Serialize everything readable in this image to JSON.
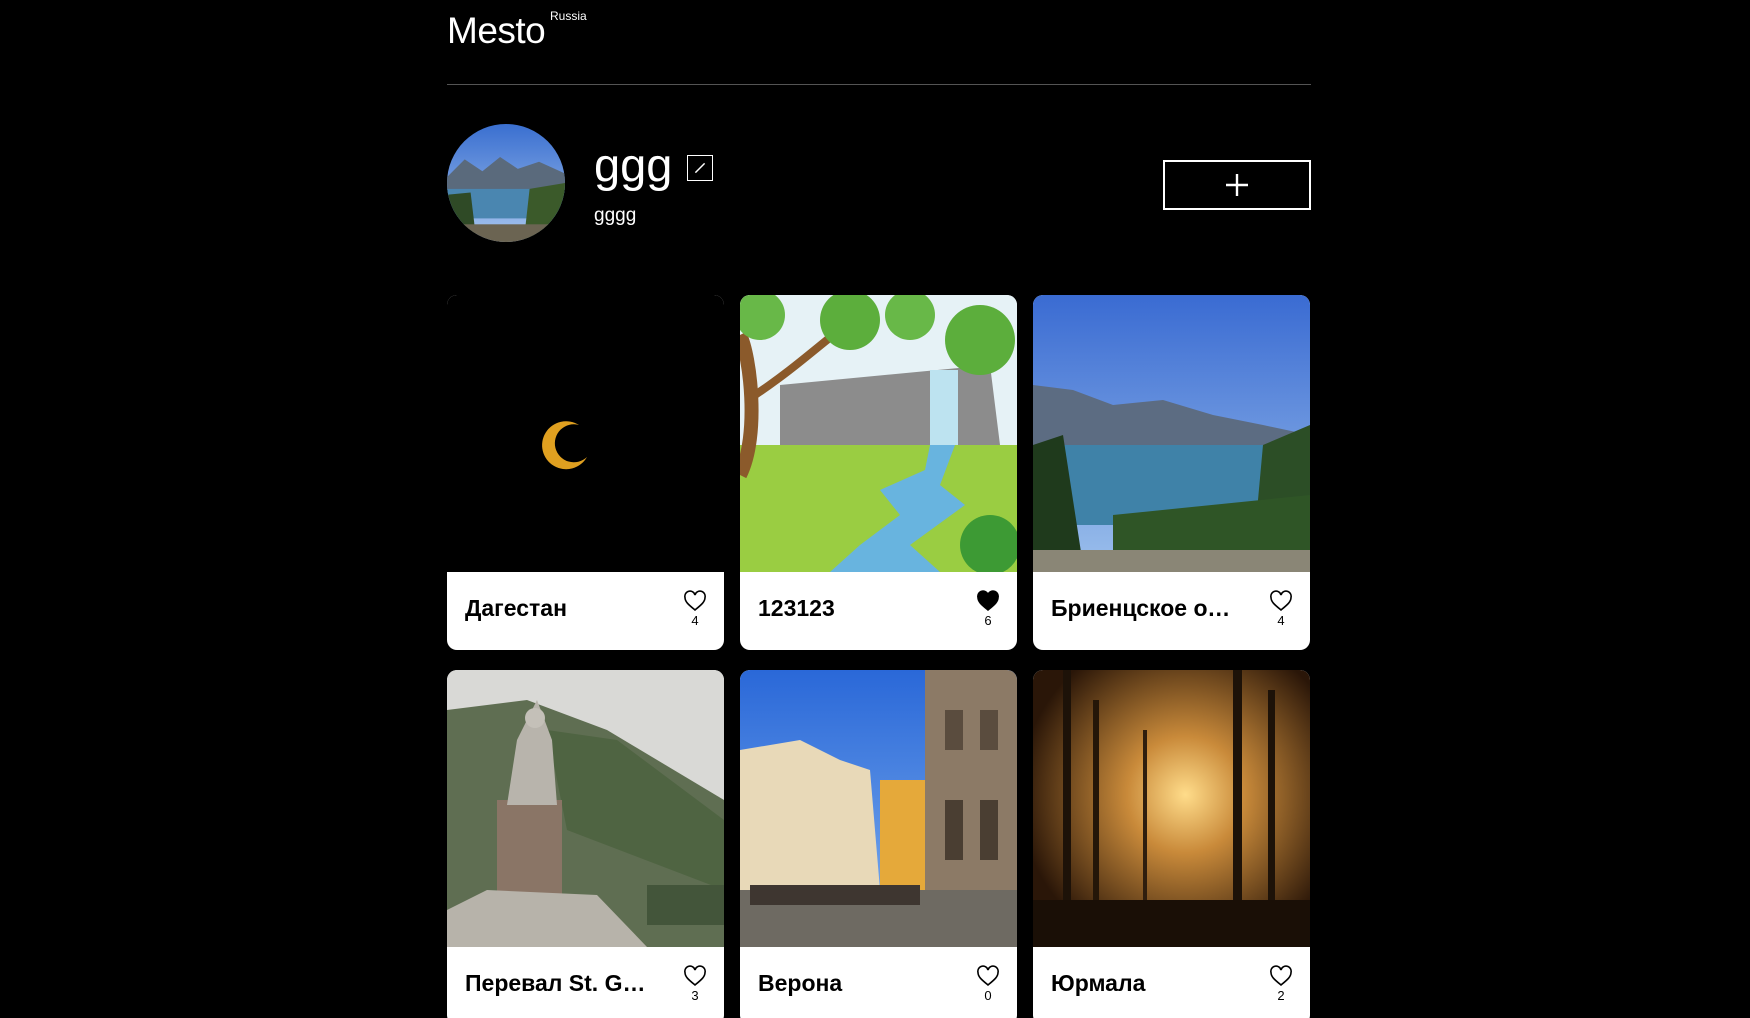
{
  "header": {
    "logo": "Mesto",
    "logo_sup": "Russia"
  },
  "profile": {
    "name": "ggg",
    "about": "gggg",
    "edit_icon": "pencil-icon",
    "add_icon": "plus-icon"
  },
  "cards": [
    {
      "title": "Дагестан",
      "likes": "4",
      "liked": false
    },
    {
      "title": "123123",
      "likes": "6",
      "liked": true
    },
    {
      "title": "Бриенцское озеро",
      "likes": "4",
      "liked": false
    },
    {
      "title": "Перевал St. Gotthard",
      "likes": "3",
      "liked": false
    },
    {
      "title": "Верона",
      "likes": "0",
      "liked": false
    },
    {
      "title": "Юрмала",
      "likes": "2",
      "liked": false
    }
  ]
}
